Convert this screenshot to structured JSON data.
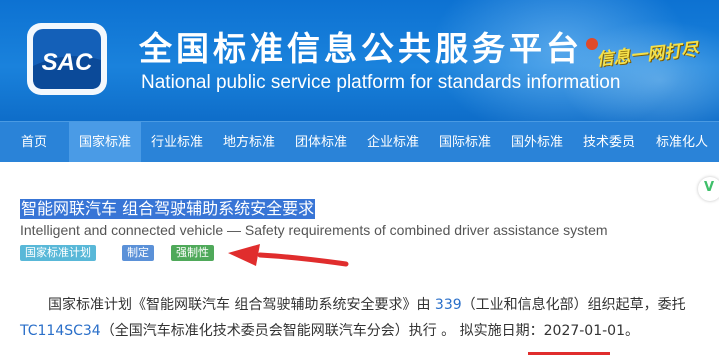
{
  "header": {
    "logo_text": "SAC",
    "title": "全国标准信息公共服务平台",
    "subtitle": "National public service platform  for standards information",
    "slogan": "信息一网打尽"
  },
  "nav": {
    "items": [
      {
        "label": "首页",
        "active": false
      },
      {
        "label": "国家标准",
        "active": true
      },
      {
        "label": "行业标准",
        "active": false
      },
      {
        "label": "地方标准",
        "active": false
      },
      {
        "label": "团体标准",
        "active": false
      },
      {
        "label": "企业标准",
        "active": false
      },
      {
        "label": "国际标准",
        "active": false
      },
      {
        "label": "国外标准",
        "active": false
      },
      {
        "label": "技术委员",
        "active": false
      },
      {
        "label": "标准化人",
        "active": false
      }
    ]
  },
  "standard": {
    "title_cn": "智能网联汽车 组合驾驶辅助系统安全要求",
    "title_en": "Intelligent and connected vehicle — Safety requirements of combined driver assistance system",
    "tags": {
      "plan": "国家标准计划",
      "type": "制定",
      "mandatory": "强制性"
    },
    "desc": {
      "part1": "国家标准计划《智能网联汽车 组合驾驶辅助系统安全要求》由 ",
      "org_code": "339",
      "part2": "（工业和信息化部）组织起草，委托",
      "committee_code": "TC114SC34",
      "part3": "（全国汽车标准化技术委员会智能网联汽车分会）执行 。 拟实施日期：",
      "date": "2027-01-01",
      "part4": "。"
    }
  },
  "side_badge": "V",
  "colors": {
    "banner": "#1a82dc",
    "nav": "#2a83d8",
    "nav_active": "#4a9be6",
    "title_highlight": "#3875d6",
    "tag_plan": "#59b8d8",
    "tag_type": "#5b91d8",
    "tag_mandatory": "#4fa95a",
    "annotation_red": "#e02d2d",
    "link": "#2a6fc9"
  }
}
